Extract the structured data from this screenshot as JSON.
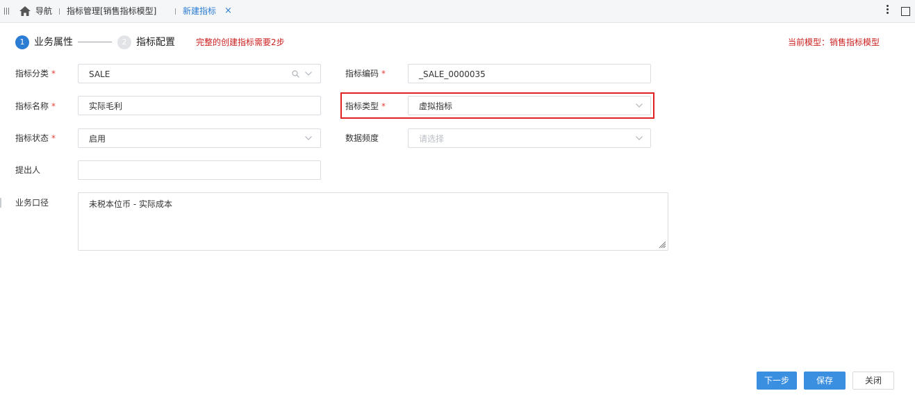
{
  "tabs": {
    "nav_label": "导航",
    "items": [
      {
        "label": "指标管理[销售指标模型]"
      },
      {
        "label": "新建指标",
        "close": "×"
      }
    ]
  },
  "steps": [
    {
      "number": "1",
      "label": "业务属性"
    },
    {
      "number": "2",
      "label": "指标配置"
    }
  ],
  "step_hint": "完整的创建指标需要2步",
  "current_model": "当前模型：销售指标模型",
  "form": {
    "category": {
      "label": "指标分类",
      "required": "*",
      "value": "SALE"
    },
    "code": {
      "label": "指标编码",
      "required": "*",
      "value": "_SALE_0000035"
    },
    "name": {
      "label": "指标名称",
      "required": "*",
      "value": "实际毛利"
    },
    "type": {
      "label": "指标类型",
      "required": "*",
      "value": "虚拟指标"
    },
    "status": {
      "label": "指标状态",
      "required": "*",
      "value": "启用"
    },
    "frequency": {
      "label": "数据频度",
      "placeholder": "请选择"
    },
    "proposer": {
      "label": "提出人",
      "value": ""
    },
    "business_definition": {
      "label": "业务口径",
      "value": "未税本位币 - 实际成本"
    }
  },
  "buttons": {
    "next": "下一步",
    "save": "保存",
    "close": "关闭"
  },
  "colors": {
    "accent": "#2b7cd3",
    "primary_button": "#3b8fe0",
    "hint_red": "#cc1f1f",
    "highlight_border": "#e02020"
  }
}
